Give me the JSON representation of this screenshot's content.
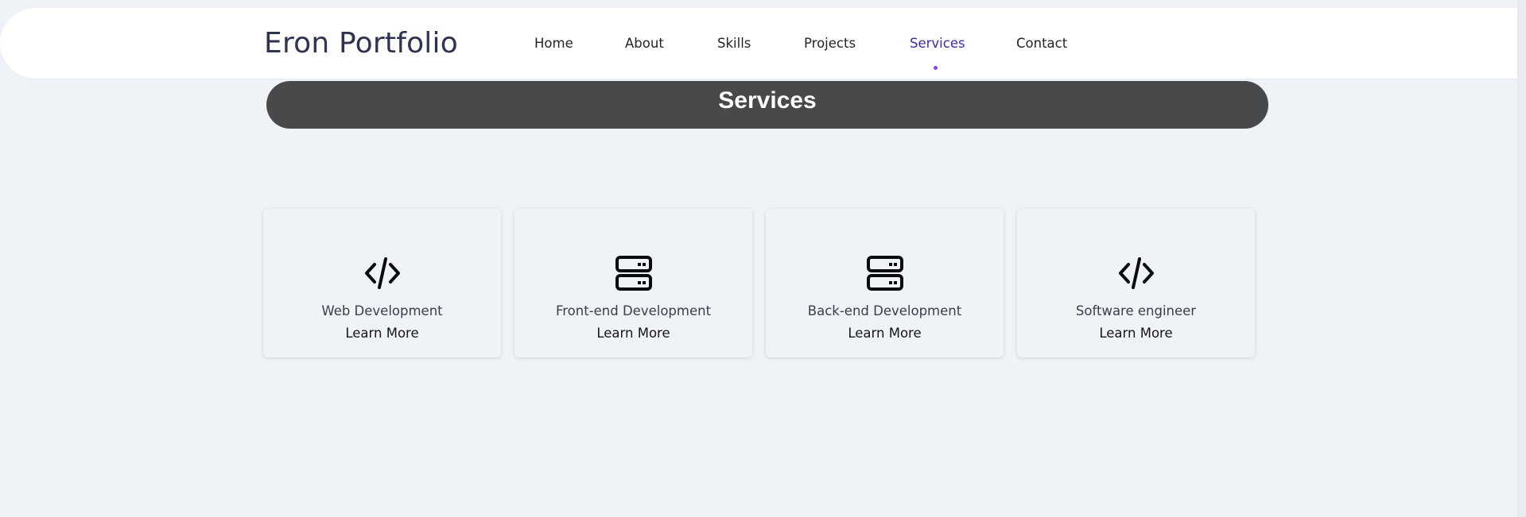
{
  "brand": "Eron Portfolio",
  "nav": {
    "items": [
      {
        "label": "Home"
      },
      {
        "label": "About"
      },
      {
        "label": "Skills"
      },
      {
        "label": "Projects"
      },
      {
        "label": "Services"
      },
      {
        "label": "Contact"
      }
    ],
    "active": "Services"
  },
  "section": {
    "title": "Services"
  },
  "services": [
    {
      "icon": "code-icon",
      "title": "Web Development",
      "link": "Learn More"
    },
    {
      "icon": "server-icon",
      "title": "Front-end Development",
      "link": "Learn More"
    },
    {
      "icon": "server-icon",
      "title": "Back-end Development",
      "link": "Learn More"
    },
    {
      "icon": "code-icon",
      "title": "Software engineer",
      "link": "Learn More"
    }
  ],
  "colors": {
    "page_bg": "#eff2f7",
    "banner_bg": "#48494b",
    "active_nav": "#3c2ba8",
    "active_dot": "#7d49e0",
    "brand_text": "#2f3350"
  }
}
